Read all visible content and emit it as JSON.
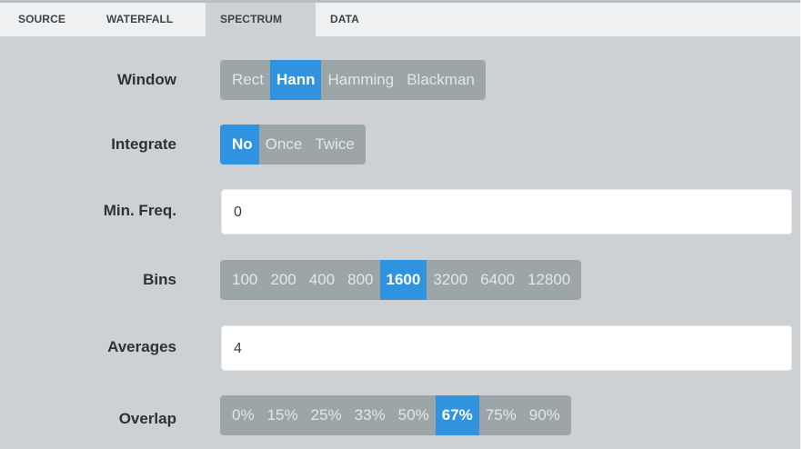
{
  "tabs": [
    "SOURCE",
    "WATERFALL",
    "SPECTRUM",
    "DATA"
  ],
  "active_tab": "SPECTRUM",
  "settings": {
    "window": {
      "label": "Window",
      "options": [
        "Rect",
        "Hann",
        "Hamming",
        "Blackman"
      ],
      "selected": "Hann"
    },
    "integrate": {
      "label": "Integrate",
      "options": [
        "No",
        "Once",
        "Twice"
      ],
      "selected": "No"
    },
    "min_freq": {
      "label": "Min. Freq.",
      "value": "0"
    },
    "bins": {
      "label": "Bins",
      "options": [
        "100",
        "200",
        "400",
        "800",
        "1600",
        "3200",
        "6400",
        "12800"
      ],
      "selected": "1600"
    },
    "averages": {
      "label": "Averages",
      "value": "4"
    },
    "overlap": {
      "label": "Overlap",
      "options": [
        "0%",
        "15%",
        "25%",
        "33%",
        "50%",
        "67%",
        "75%",
        "90%"
      ],
      "selected": "67%"
    }
  },
  "colors": {
    "accent": "#2f93e0",
    "segment_bg": "#9ca6a8",
    "panel_bg": "#cdd1d4",
    "tabbar_bg": "#eef0f1"
  }
}
